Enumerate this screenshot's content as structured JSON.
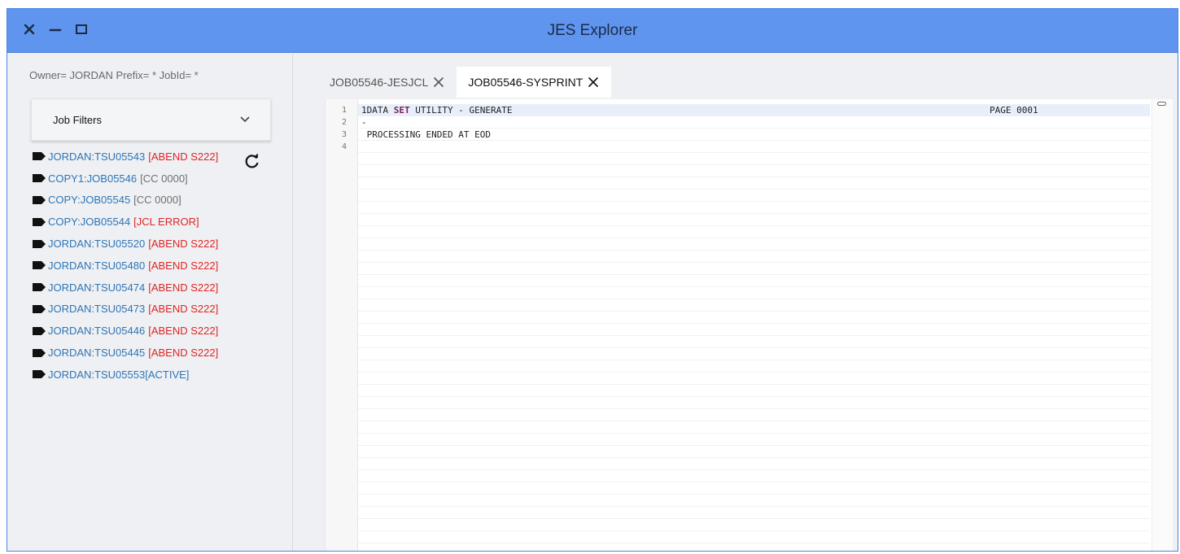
{
  "window": {
    "title": "JES Explorer",
    "controls": [
      "close-icon",
      "minimize-icon",
      "maximize-icon"
    ],
    "colors": {
      "titlebar": "#5f95ef",
      "link": "#2f74b5",
      "error": "#e02424"
    }
  },
  "sidebar": {
    "owner_line": "Owner= JORDAN Prefix= * JobId= *",
    "filters_label": "Job Filters",
    "jobs": [
      {
        "name": "JORDAN:TSU05543",
        "status": "[ABEND S222]",
        "kind": "err"
      },
      {
        "name": "COPY1:JOB05546",
        "status": "[CC 0000]",
        "kind": "ok"
      },
      {
        "name": "COPY:JOB05545",
        "status": "[CC 0000]",
        "kind": "ok"
      },
      {
        "name": "COPY:JOB05544",
        "status": "[JCL ERROR]",
        "kind": "err"
      },
      {
        "name": "JORDAN:TSU05520",
        "status": "[ABEND S222]",
        "kind": "err"
      },
      {
        "name": "JORDAN:TSU05480",
        "status": "[ABEND S222]",
        "kind": "err"
      },
      {
        "name": "JORDAN:TSU05474",
        "status": "[ABEND S222]",
        "kind": "err"
      },
      {
        "name": "JORDAN:TSU05473",
        "status": "[ABEND S222]",
        "kind": "err"
      },
      {
        "name": "JORDAN:TSU05446",
        "status": "[ABEND S222]",
        "kind": "err"
      },
      {
        "name": "JORDAN:TSU05445",
        "status": "[ABEND S222]",
        "kind": "err"
      },
      {
        "name": "JORDAN:TSU05553",
        "status": "[ACTIVE]",
        "kind": "active"
      }
    ]
  },
  "tabs": [
    {
      "label": "JOB05546-JESJCL",
      "active": false
    },
    {
      "label": "JOB05546-SYSPRINT",
      "active": true
    }
  ],
  "editor": {
    "line_numbers": [
      "1",
      "2",
      "3",
      "4"
    ],
    "lines": [
      {
        "pre": "1DATA ",
        "kw": "SET",
        "post": " UTILITY - GENERATE",
        "right": "PAGE 0001"
      },
      {
        "pre": "-",
        "kw": "",
        "post": "",
        "right": ""
      },
      {
        "pre": " PROCESSING ENDED AT EOD",
        "kw": "",
        "post": "",
        "right": ""
      },
      {
        "pre": "",
        "kw": "",
        "post": "",
        "right": ""
      }
    ]
  }
}
